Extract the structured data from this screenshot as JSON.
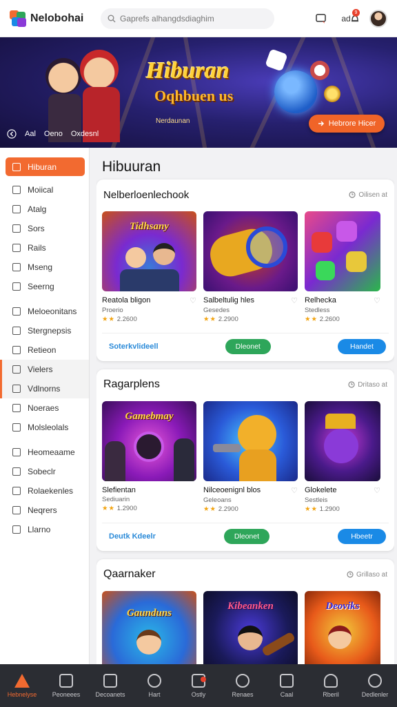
{
  "app": {
    "name": "Nelobohai"
  },
  "search": {
    "placeholder": "Gaprefs alhangdsdiaghim"
  },
  "topbar": {
    "help_label": "",
    "lang_label": "ad",
    "notif_count": "9"
  },
  "banner": {
    "title": "Hiburan",
    "subtitle": "Oqhbuen us",
    "tag": "Nerdaunan",
    "cta": "Hebrore Hicer",
    "nav": [
      "Aal",
      "Oeno",
      "Oxdesnl"
    ]
  },
  "sidebar": {
    "items": [
      {
        "label": "Hiburan",
        "state": "active"
      },
      {
        "label": "Moiical"
      },
      {
        "label": "Atalg"
      },
      {
        "label": "Sors"
      },
      {
        "label": "Rails"
      },
      {
        "label": "Mseng"
      },
      {
        "label": "Seerng"
      },
      {
        "label": "Meloeonitans"
      },
      {
        "label": "Stergnepsis"
      },
      {
        "label": "Retieon"
      },
      {
        "label": "Vielers",
        "state": "highlight"
      },
      {
        "label": "Vdlnorns",
        "state": "highlight"
      },
      {
        "label": "Noeraes"
      },
      {
        "label": "Molsleolals"
      },
      {
        "label": "Heomeaame"
      },
      {
        "label": "Sobeclr"
      },
      {
        "label": "Rolaekenles"
      },
      {
        "label": "Neqrers"
      },
      {
        "label": "Llarno"
      }
    ]
  },
  "main": {
    "title": "Hibuuran",
    "sections": [
      {
        "title": "Nelberloenlechook",
        "link": "Oilisen at",
        "footer_link": "Soterkvlideell",
        "btn_green": "Dleonet",
        "btn_blue": "Handet",
        "games": [
          {
            "name": "Reatola bligon",
            "meta": "Proerio",
            "stars": "★★",
            "rating": "2.2600",
            "thumb_text": "Tidhsany"
          },
          {
            "name": "Salbeltulig hles",
            "meta": "Gesedes",
            "stars": "★★",
            "rating": "2.2900",
            "thumb_text": ""
          },
          {
            "name": "Relhecka",
            "meta": "Stedless",
            "stars": "★★",
            "rating": "2.2600",
            "thumb_text": ""
          }
        ]
      },
      {
        "title": "Ragarplens",
        "link": "Dritaso at",
        "footer_link": "Deutk Kdeelr",
        "btn_green": "Dleonet",
        "btn_blue": "Hbeetr",
        "games": [
          {
            "name": "Slefientan",
            "meta": "Sediuarin",
            "stars": "★★",
            "rating": "1.2900",
            "thumb_text": "Gamebmay"
          },
          {
            "name": "Nilceoenignl blos",
            "meta": "Geleoans",
            "stars": "★★",
            "rating": "2.2900",
            "thumb_text": ""
          },
          {
            "name": "Glokelete",
            "meta": "Sestleis",
            "stars": "★★",
            "rating": "1.2900",
            "thumb_text": ""
          }
        ]
      },
      {
        "title": "Qaarnaker",
        "link": "Grillaso at",
        "games": [
          {
            "name": "",
            "meta": "",
            "stars": "",
            "rating": "",
            "thumb_text": "Gaunduns"
          },
          {
            "name": "",
            "meta": "",
            "stars": "",
            "rating": "",
            "thumb_text": "Kibeanken"
          },
          {
            "name": "",
            "meta": "",
            "stars": "",
            "rating": "",
            "thumb_text": "Deoviks"
          }
        ]
      }
    ]
  },
  "bottomnav": {
    "items": [
      {
        "label": "Hebnelyse",
        "icon": "home-icon",
        "active": true
      },
      {
        "label": "Peoneees",
        "icon": "page-icon"
      },
      {
        "label": "Decoanets",
        "icon": "list-icon"
      },
      {
        "label": "Hart",
        "icon": "tools-icon"
      },
      {
        "label": "Ostly",
        "icon": "gamepad-icon",
        "badge": true
      },
      {
        "label": "Renaes",
        "icon": "compass-icon"
      },
      {
        "label": "Caal",
        "icon": "calendar-icon"
      },
      {
        "label": "Rberil",
        "icon": "user-icon"
      },
      {
        "label": "Dedlenler",
        "icon": "profile-icon"
      }
    ]
  }
}
